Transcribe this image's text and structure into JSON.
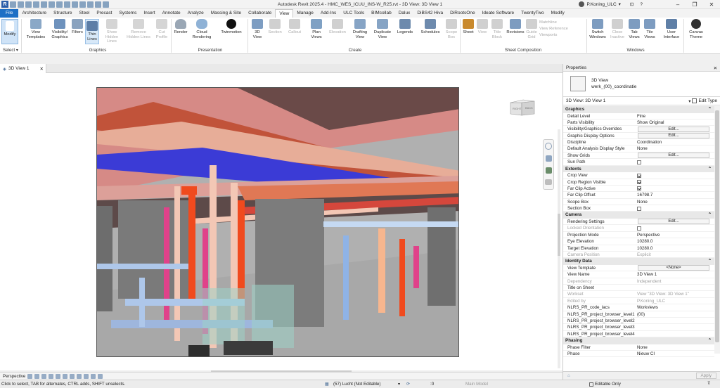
{
  "title": "Autodesk Revit 2025.4 - HMC_WES_ICUU_INS-W_R25.rvt - 3D View: 3D View 1",
  "user": "P.Koning_ULC",
  "tabs": [
    "File",
    "Architecture",
    "Structure",
    "Steel",
    "Precast",
    "Systems",
    "Insert",
    "Annotate",
    "Analyze",
    "Massing & Site",
    "Collaborate",
    "View",
    "Manage",
    "Add-Ins",
    "ULC Tools",
    "BIMcollab",
    "Dalux",
    "DiBS42 Hiva",
    "DiRootsOne",
    "Ideate Software",
    "TwentyTwo",
    "Modify"
  ],
  "ribbon": {
    "modify": "Modify",
    "select": "Select ▾",
    "graphics": {
      "label": "Graphics",
      "view_templates": "View Templates",
      "visibility_graphics": "Visibility/ Graphics",
      "filters": "Filters",
      "thin_lines": "Thin Lines",
      "show_hidden_lines": "Show Hidden Lines",
      "remove_hidden_lines": "Remove Hidden Lines",
      "cut_profile": "Cut Profile"
    },
    "presentation": {
      "label": "Presentation",
      "render": "Render",
      "cloud_rendering": "Cloud Rendering",
      "twinmotion": "Twinmotion"
    },
    "create": {
      "label": "Create",
      "view3d": "3D View",
      "section": "Section",
      "callout": "Callout",
      "plan_views": "Plan Views",
      "elevation": "Elevation",
      "drafting_view": "Drafting View",
      "duplicate_view": "Duplicate View",
      "legends": "Legends",
      "schedules": "Schedules",
      "scope_box": "Scope Box"
    },
    "sheet": {
      "label": "Sheet Composition",
      "sheet": "Sheet",
      "view": "View",
      "title_block": "Title Block",
      "revisions": "Revisions",
      "guide_grid": "Guide Grid",
      "matchline": "Matchline",
      "view_reference": "View Reference",
      "viewports": "Viewports"
    },
    "windows": {
      "label": "Windows",
      "switch_windows": "Switch Windows",
      "close_inactive": "Close Inactive",
      "tab_views": "Tab Views",
      "tile_views": "Tile Views",
      "user_interface": "User Interface",
      "canvas_theme": "Canvas Theme"
    }
  },
  "view_tab": "3D View 1",
  "view_control": "Perspective",
  "viewcube": {
    "right": "RIGHT",
    "back": "BACK"
  },
  "properties": {
    "title": "Properties",
    "type_name": "3D View",
    "type_sub": "werk_(00)_coordinatie",
    "instance_filter": "3D View: 3D View 1",
    "edit_type": "Edit Type",
    "groups": [
      {
        "name": "Graphics",
        "rows": [
          {
            "k": "Detail Level",
            "v": "Fine"
          },
          {
            "k": "Parts Visibility",
            "v": "Show Original"
          },
          {
            "k": "Visibility/Graphics Overrides",
            "v": "Edit...",
            "btn": true
          },
          {
            "k": "Graphic Display Options",
            "v": "Edit...",
            "btn": true
          },
          {
            "k": "Discipline",
            "v": "Coordination"
          },
          {
            "k": "Default Analysis Display Style",
            "v": "None"
          },
          {
            "k": "Show Grids",
            "v": "Edit...",
            "btn": true
          },
          {
            "k": "Sun Path",
            "v": "",
            "cb": false
          }
        ]
      },
      {
        "name": "Extents",
        "rows": [
          {
            "k": "Crop View",
            "v": "",
            "cb": true
          },
          {
            "k": "Crop Region Visible",
            "v": "",
            "cb": true
          },
          {
            "k": "Far Clip Active",
            "v": "",
            "cb": true
          },
          {
            "k": "Far Clip Offset",
            "v": "16798.7"
          },
          {
            "k": "Scope Box",
            "v": "None"
          },
          {
            "k": "Section Box",
            "v": "",
            "cb": false
          }
        ]
      },
      {
        "name": "Camera",
        "rows": [
          {
            "k": "Rendering Settings",
            "v": "Edit...",
            "btn": true
          },
          {
            "k": "Locked Orientation",
            "v": "",
            "cb": false,
            "dim": true
          },
          {
            "k": "Projection Mode",
            "v": "Perspective"
          },
          {
            "k": "Eye Elevation",
            "v": "10280.0"
          },
          {
            "k": "Target Elevation",
            "v": "10280.0"
          },
          {
            "k": "Camera Position",
            "v": "Explicit",
            "dim": true
          }
        ]
      },
      {
        "name": "Identity Data",
        "rows": [
          {
            "k": "View Template",
            "v": "<None>",
            "btn": true
          },
          {
            "k": "View Name",
            "v": "3D View 1"
          },
          {
            "k": "Dependency",
            "v": "Independent",
            "dim": true
          },
          {
            "k": "Title on Sheet",
            "v": ""
          },
          {
            "k": "Workset",
            "v": "View \"3D View: 3D View 1\"",
            "dim": true
          },
          {
            "k": "Edited by",
            "v": "P.Koning_ULC",
            "dim": true
          },
          {
            "k": "NLRS_PR_code_lacs",
            "v": "Workviews"
          },
          {
            "k": "NLRS_PR_project_browser_level1",
            "v": "(00)"
          },
          {
            "k": "NLRS_PR_project_browser_level2",
            "v": ""
          },
          {
            "k": "NLRS_PR_project_browser_level3",
            "v": ""
          },
          {
            "k": "NLRS_PR_project_browser_level4",
            "v": ""
          }
        ]
      },
      {
        "name": "Phasing",
        "rows": [
          {
            "k": "Phase Filter",
            "v": "None"
          },
          {
            "k": "Phase",
            "v": "Nieuw CI"
          }
        ]
      }
    ],
    "apply": "Apply"
  },
  "status": {
    "hint": "Click to select, TAB for alternates, CTRL adds, SHIFT unselects.",
    "workset": "(57) Lucht (Not Editable)",
    "zero": ":0",
    "model": "Main Model",
    "editable_only": "Editable Only"
  }
}
